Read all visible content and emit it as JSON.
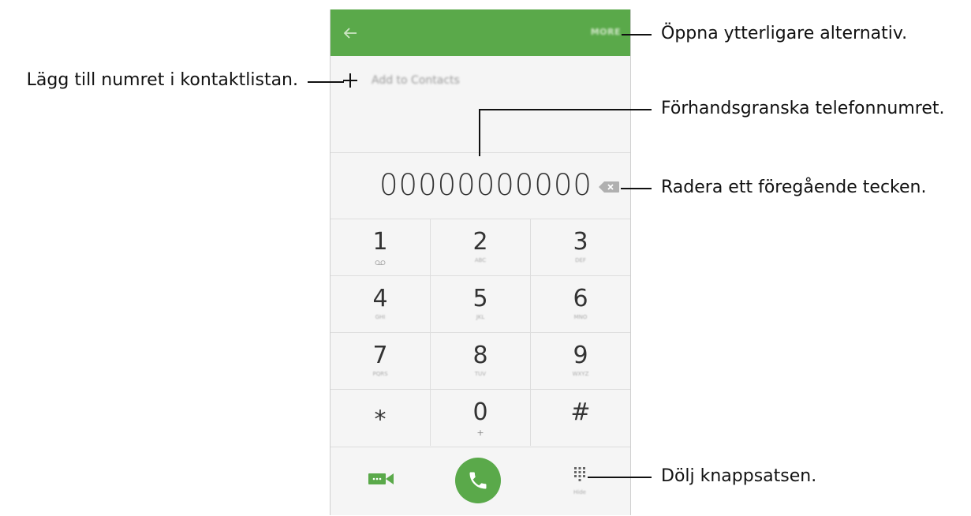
{
  "app": {
    "more_label": "MORE",
    "add_to_contacts_label": "Add to Contacts",
    "phone_number": "00000000000",
    "keys": [
      {
        "digit": "1",
        "letters": ""
      },
      {
        "digit": "2",
        "letters": "ABC"
      },
      {
        "digit": "3",
        "letters": "DEF"
      },
      {
        "digit": "4",
        "letters": "GHI"
      },
      {
        "digit": "5",
        "letters": "JKL"
      },
      {
        "digit": "6",
        "letters": "MNO"
      },
      {
        "digit": "7",
        "letters": "PQRS"
      },
      {
        "digit": "8",
        "letters": "TUV"
      },
      {
        "digit": "9",
        "letters": "WXYZ"
      },
      {
        "digit": "⁎",
        "letters": ""
      },
      {
        "digit": "0",
        "letters": "+"
      },
      {
        "digit": "#",
        "letters": ""
      }
    ],
    "hide_label": "Hide",
    "accent_color": "#5aa94a"
  },
  "annotations": {
    "more": "Öppna ytterligare alternativ.",
    "add_contact": "Lägg till numret i kontaktlistan.",
    "preview": "Förhandsgranska telefonnumret.",
    "delete": "Radera ett föregående tecken.",
    "hide_keypad": "Dölj knappsatsen."
  },
  "icons": [
    "back-arrow-icon",
    "plus-icon",
    "backspace-icon",
    "voicemail-icon",
    "video-call-icon",
    "phone-icon",
    "keypad-grid-icon"
  ]
}
